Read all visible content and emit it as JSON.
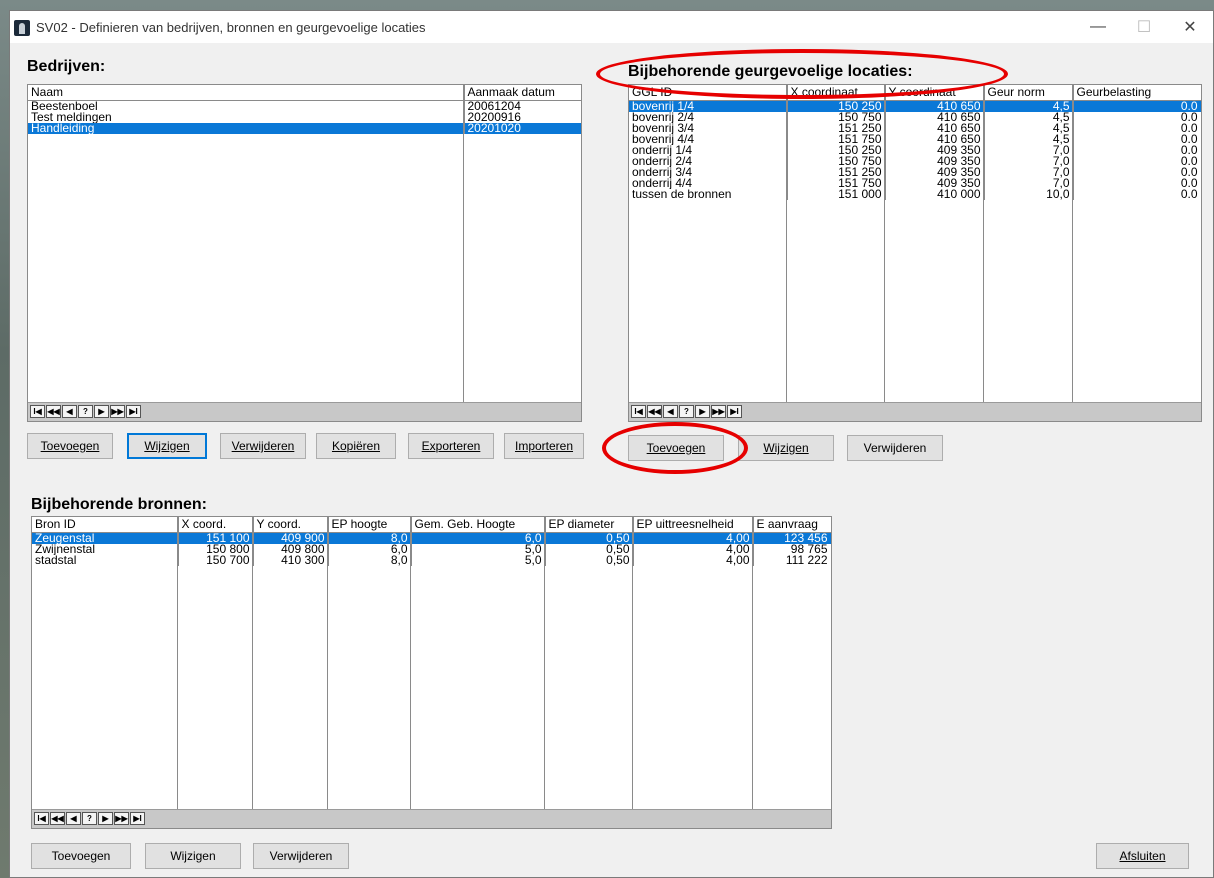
{
  "window": {
    "title": "SV02 - Definieren van bedrijven, bronnen en  geurgevoelige locaties"
  },
  "bedrijven": {
    "title": "Bedrijven:",
    "columns": [
      "Naam",
      "Aanmaak datum"
    ],
    "rows": [
      [
        "Beestenboel",
        "20061204"
      ],
      [
        "Test meldingen",
        "20200916"
      ],
      [
        "Handleiding",
        "20201020"
      ]
    ],
    "selected_index": 2,
    "buttons": [
      "Toevoegen",
      "Wijzigen",
      "Verwijderen",
      "Kopiëren",
      "Exporteren",
      "Importeren"
    ]
  },
  "locaties": {
    "title": "Bijbehorende geurgevoelige locaties:",
    "columns": [
      "GGL ID",
      "X coordinaat",
      "Y coordinaat",
      "Geur norm",
      "Geurbelasting"
    ],
    "rows": [
      [
        "bovenrij 1/4",
        "150 250",
        "410 650",
        "4,5",
        "0.0"
      ],
      [
        "bovenrij 2/4",
        "150 750",
        "410 650",
        "4,5",
        "0.0"
      ],
      [
        "bovenrij 3/4",
        "151 250",
        "410 650",
        "4,5",
        "0.0"
      ],
      [
        "bovenrij 4/4",
        "151 750",
        "410 650",
        "4,5",
        "0.0"
      ],
      [
        "onderrij 1/4",
        "150 250",
        "409 350",
        "7,0",
        "0.0"
      ],
      [
        "onderrij 2/4",
        "150 750",
        "409 350",
        "7,0",
        "0.0"
      ],
      [
        "onderrij 3/4",
        "151 250",
        "409 350",
        "7,0",
        "0.0"
      ],
      [
        "onderrij 4/4",
        "151 750",
        "409 350",
        "7,0",
        "0.0"
      ],
      [
        "tussen de bronnen",
        "151 000",
        "410 000",
        "10,0",
        "0.0"
      ]
    ],
    "selected_index": 0,
    "buttons": [
      "Toevoegen",
      "Wijzigen",
      "Verwijderen"
    ]
  },
  "bronnen": {
    "title": "Bijbehorende bronnen:",
    "columns": [
      "Bron ID",
      "X coord.",
      "Y coord.",
      "EP hoogte",
      "Gem. Geb. Hoogte",
      "EP diameter",
      "EP uittreesnelheid",
      "E aanvraag"
    ],
    "rows": [
      [
        "Zeugenstal",
        "151 100",
        "409 900",
        "8,0",
        "6,0",
        "0,50",
        "4,00",
        "123 456"
      ],
      [
        "Zwijnenstal",
        "150 800",
        "409 800",
        "6,0",
        "5,0",
        "0,50",
        "4,00",
        "98 765"
      ],
      [
        "stadstal",
        "150 700",
        "410 300",
        "8,0",
        "5,0",
        "0,50",
        "4,00",
        "111 222"
      ]
    ],
    "selected_index": 0,
    "buttons": [
      "Toevoegen",
      "Wijzigen",
      "Verwijderen"
    ]
  },
  "close_button": "Afsluiten",
  "nav_symbols": [
    "I◀",
    "◀◀",
    "◀",
    "?",
    "▶",
    "▶▶",
    "▶I"
  ]
}
